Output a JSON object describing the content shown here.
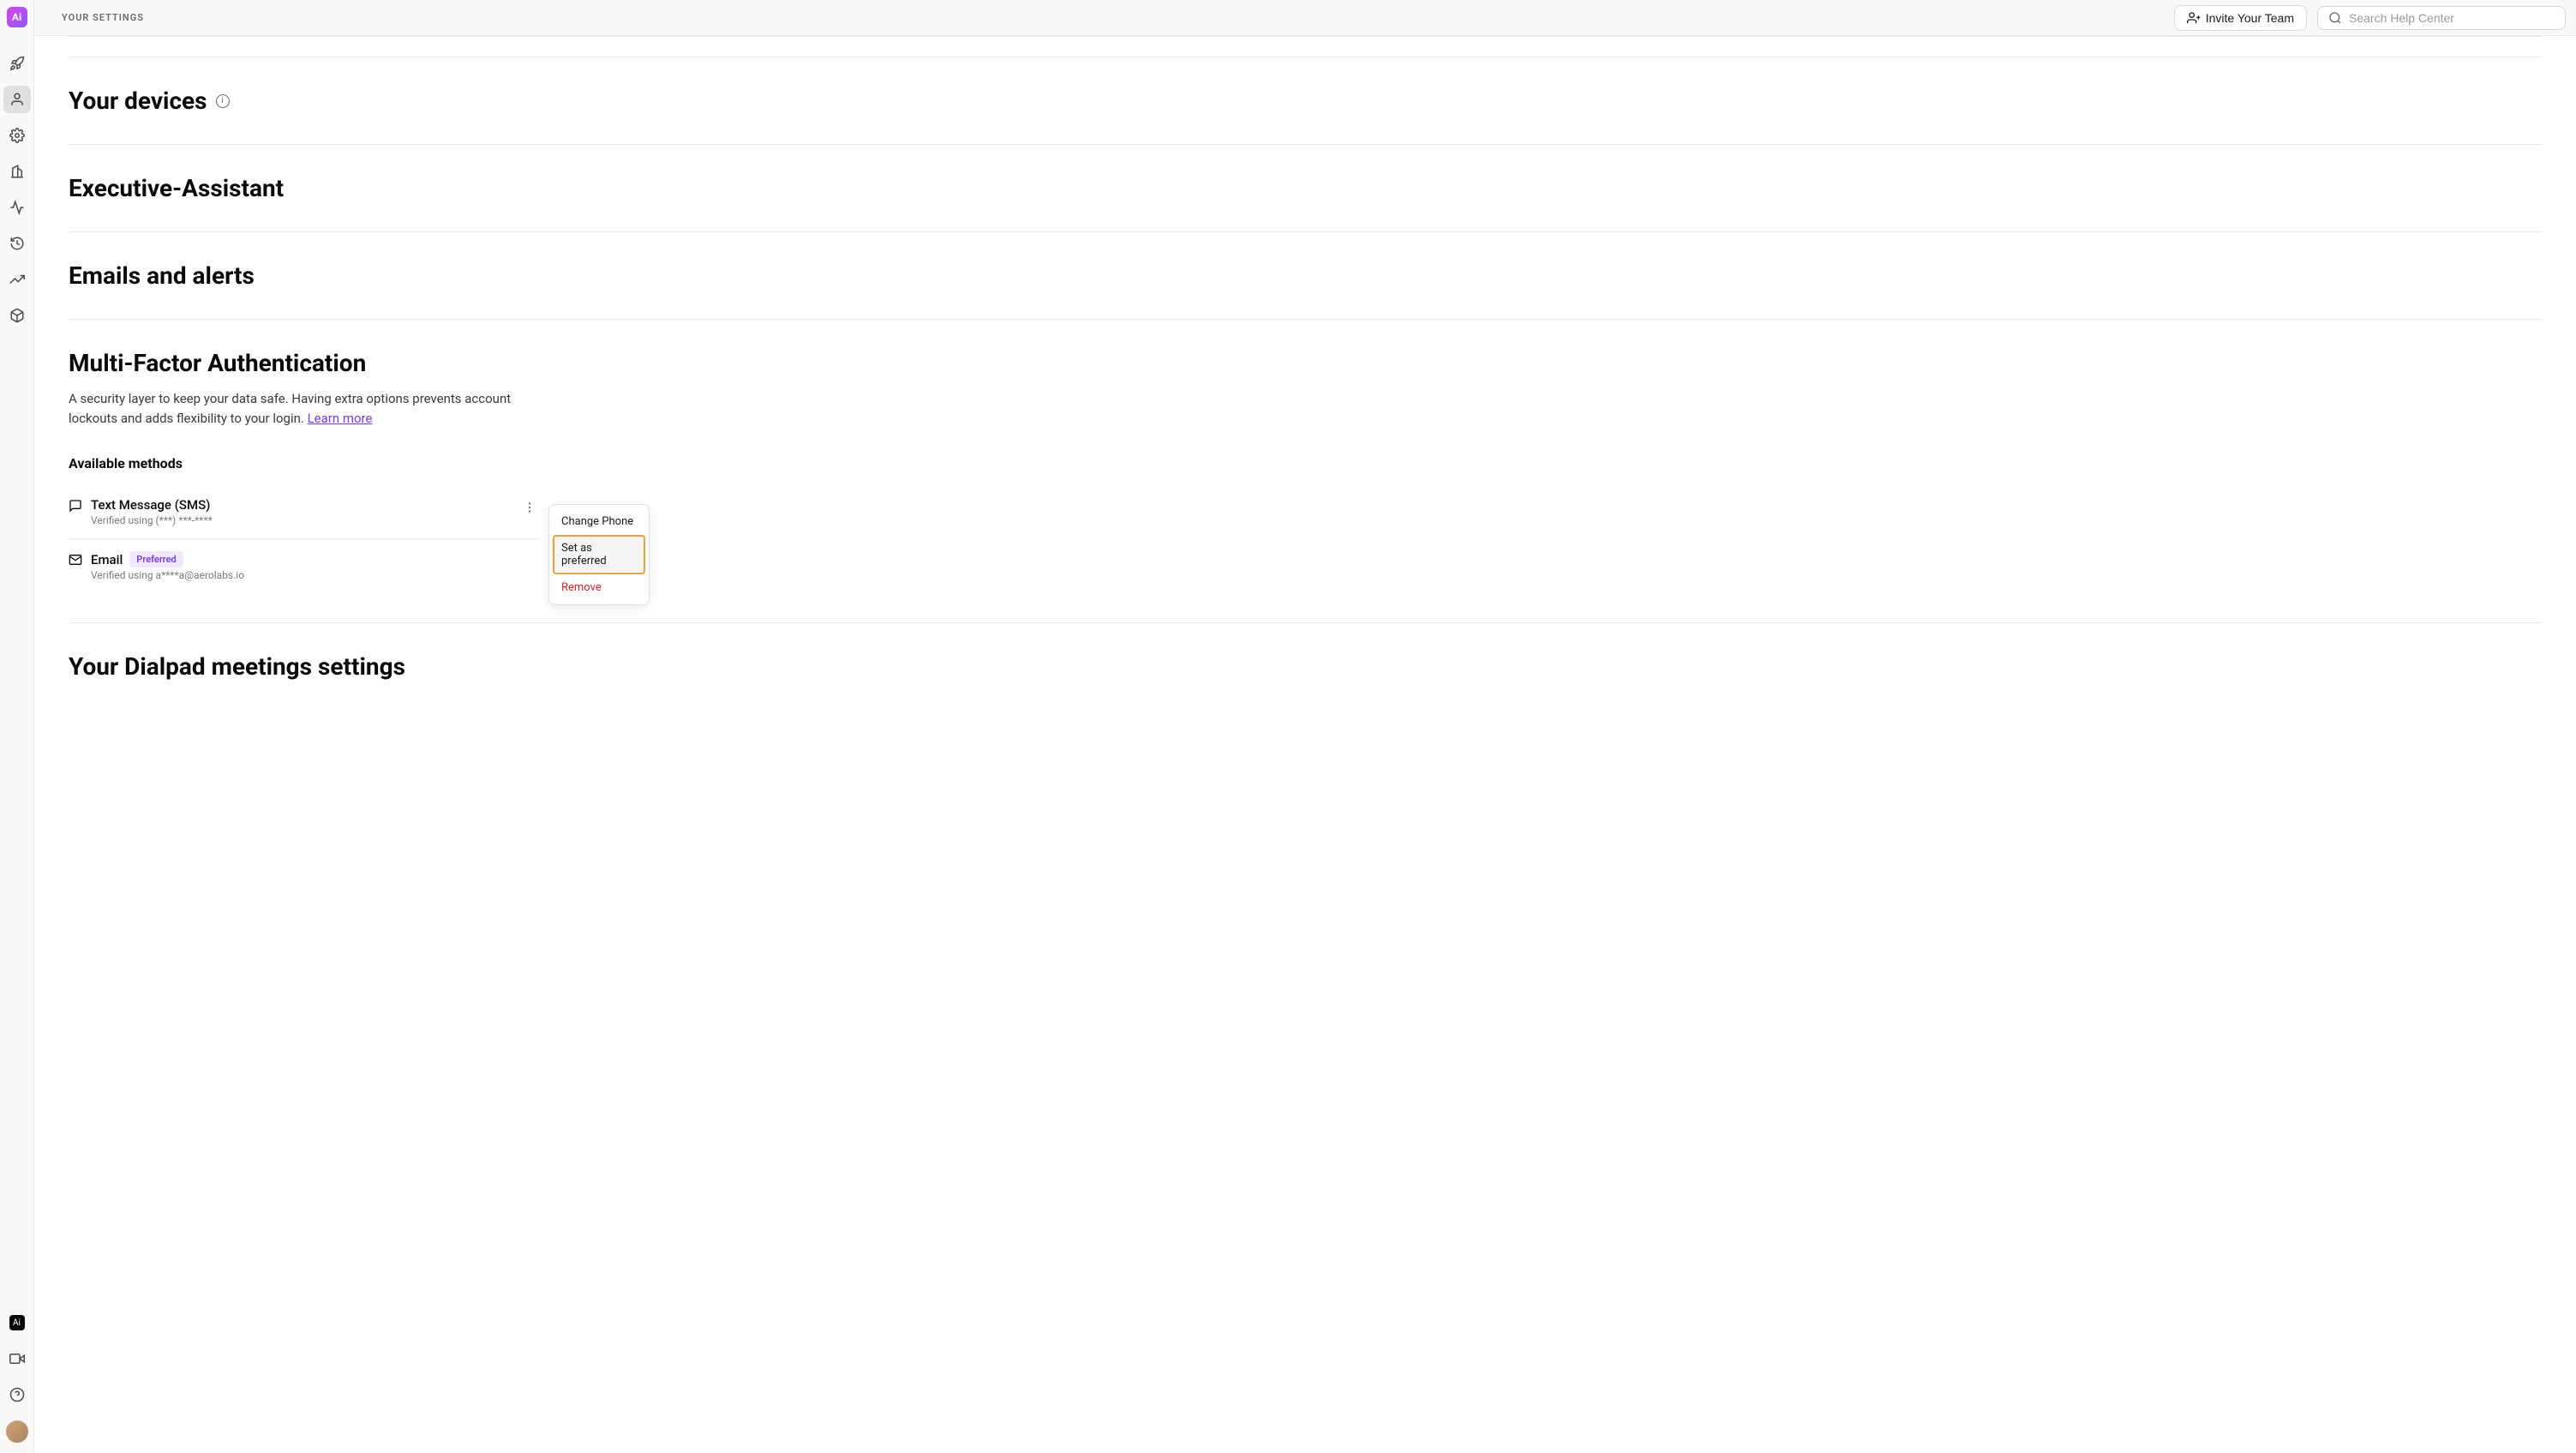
{
  "header": {
    "title": "YOUR SETTINGS",
    "invite_label": "Invite Your Team",
    "search_placeholder": "Search Help Center"
  },
  "sections": {
    "devices": {
      "heading": "Your devices"
    },
    "assistant": {
      "heading": "Executive-Assistant"
    },
    "emails": {
      "heading": "Emails and alerts"
    },
    "mfa": {
      "heading": "Multi-Factor Authentication",
      "description_part1": "A security layer to keep your data safe. Having extra options prevents account lockouts and adds flexibility to your login. ",
      "learn_more": "Learn more",
      "subsection": "Available methods",
      "methods": {
        "sms": {
          "title": "Text Message (SMS)",
          "subtitle": "Verified using (***) ***-****"
        },
        "email": {
          "title": "Email",
          "badge": "Preferred",
          "subtitle": "Verified using a****a@aerolabs.io"
        }
      }
    },
    "meetings": {
      "heading": "Your Dialpad meetings settings"
    }
  },
  "dropdown": {
    "change_phone": "Change Phone",
    "set_preferred": "Set as preferred",
    "remove": "Remove"
  },
  "sidebar": {
    "logo_text": "Ai"
  }
}
